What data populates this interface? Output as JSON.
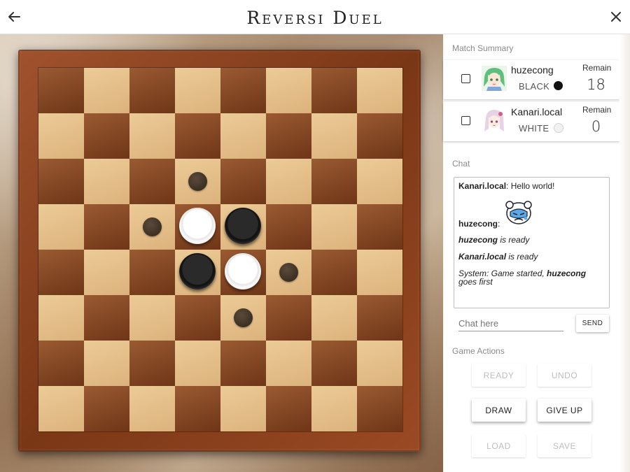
{
  "header": {
    "title": "Reversi Duel",
    "back_icon": "arrow-left-icon",
    "close_icon": "close-icon"
  },
  "board": {
    "size": 8,
    "pieces": [
      {
        "row": 3,
        "col": 3,
        "color": "white"
      },
      {
        "row": 3,
        "col": 4,
        "color": "black"
      },
      {
        "row": 4,
        "col": 3,
        "color": "black"
      },
      {
        "row": 4,
        "col": 4,
        "color": "white"
      }
    ],
    "hints": [
      {
        "row": 2,
        "col": 3
      },
      {
        "row": 3,
        "col": 2
      },
      {
        "row": 4,
        "col": 5
      },
      {
        "row": 5,
        "col": 4
      }
    ]
  },
  "summary": {
    "title": "Match Summary",
    "players": [
      {
        "name": "huzecong",
        "color_label": "BLACK",
        "remain_label": "Remain",
        "remain": "18",
        "stone": "black"
      },
      {
        "name": "Kanari.local",
        "color_label": "WHITE",
        "remain_label": "Remain",
        "remain": "0",
        "stone": "white"
      }
    ]
  },
  "chat": {
    "title": "Chat",
    "messages": [
      {
        "name": "Kanari.local",
        "sep": ": ",
        "text": "Hello world!"
      },
      {
        "name": "huzecong",
        "sep": ":",
        "text": ""
      },
      {
        "name": "huzecong",
        "sep": " ",
        "text": "is ready"
      },
      {
        "name": "Kanari.local",
        "sep": " ",
        "text": "is ready"
      },
      {
        "prefix": "System: Game started, ",
        "name": "huzecong",
        "suffix": " goes first"
      }
    ],
    "input_placeholder": "Chat here",
    "send_label": "SEND"
  },
  "actions": {
    "title": "Game Actions",
    "ready": "READY",
    "undo": "UNDO",
    "draw": "DRAW",
    "give_up": "GIVE UP",
    "load": "LOAD",
    "save": "SAVE"
  }
}
